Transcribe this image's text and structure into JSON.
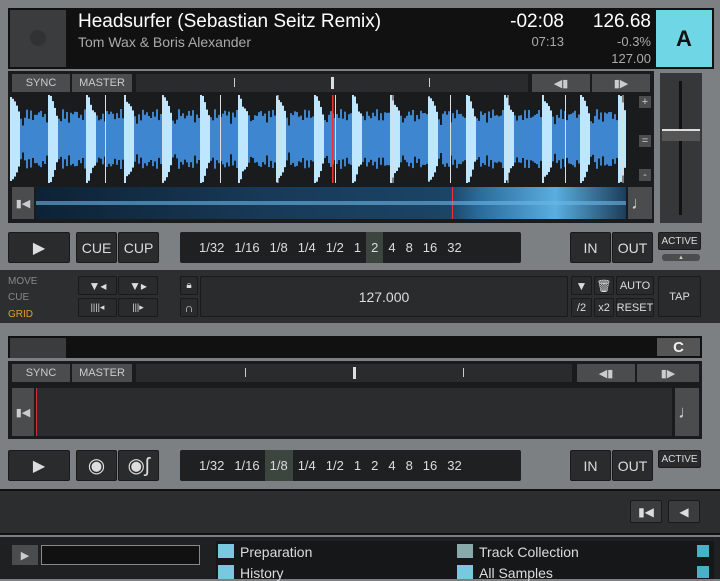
{
  "deck_a": {
    "title": "Headsurfer (Sebastian Seitz Remix)",
    "artist": "Tom Wax & Boris Alexander",
    "remaining": "-02:08",
    "length": "07:13",
    "bpm": "126.68",
    "pitch": "-0.3%",
    "base_bpm": "127.00",
    "letter": "A",
    "accent": "#6fd6e6",
    "sync": "SYNC",
    "master": "MASTER",
    "play": "▶",
    "cue": "CUE",
    "cup": "CUP",
    "in": "IN",
    "out": "OUT",
    "active": "ACTIVE",
    "loop_sizes": [
      "1/32",
      "1/16",
      "1/8",
      "1/4",
      "1/2",
      "1",
      "2",
      "4",
      "8",
      "16",
      "32"
    ],
    "loop_selected": "2",
    "grid_modes": [
      "MOVE",
      "CUE",
      "GRID"
    ],
    "grid_active": "GRID",
    "grid_bpm": "127.000",
    "auto": "AUTO",
    "reset": "RESET",
    "half": "/2",
    "double": "x2",
    "tap": "TAP",
    "zoom_in": "+",
    "zoom_fit": "=",
    "zoom_out": "-"
  },
  "deck_c": {
    "letter": "C",
    "sync": "SYNC",
    "master": "MASTER",
    "play": "▶",
    "in": "IN",
    "out": "OUT",
    "active": "ACTIVE",
    "loop_sizes": [
      "1/32",
      "1/16",
      "1/8",
      "1/4",
      "1/2",
      "1",
      "2",
      "4",
      "8",
      "16",
      "32"
    ],
    "loop_selected": "1/8"
  },
  "browser": {
    "search_value": "",
    "tree": [
      "Preparation",
      "Track Collection",
      "History",
      "All Samples"
    ]
  }
}
